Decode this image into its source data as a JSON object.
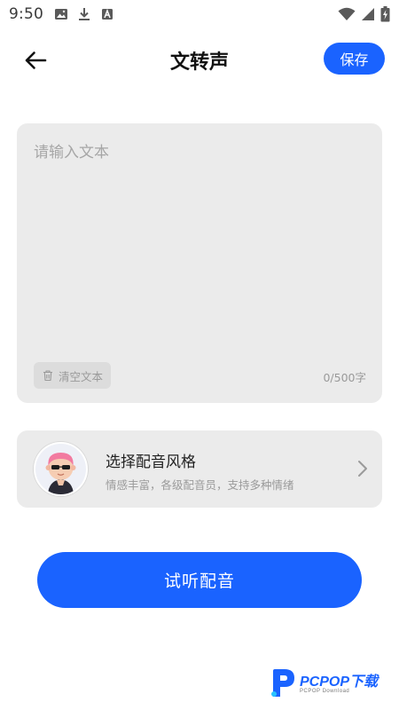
{
  "status_bar": {
    "time": "9:50",
    "icons_left": [
      "image-icon",
      "download-icon",
      "text-a-icon"
    ],
    "icons_right": [
      "wifi-icon",
      "signal-icon",
      "battery-charging-icon"
    ]
  },
  "header": {
    "back_icon": "arrow-left-icon",
    "title": "文转声",
    "save_label": "保存"
  },
  "text_input": {
    "placeholder": "请输入文本",
    "value": "",
    "clear_label": "清空文本",
    "clear_icon": "trash-icon",
    "char_count": "0/500字"
  },
  "voice_style": {
    "title": "选择配音风格",
    "subtitle": "情感丰富，各级配音员，支持多种情绪",
    "avatar_icon": "avatar-icon",
    "chevron_icon": "chevron-right-icon"
  },
  "preview_label": "试听配音",
  "watermark": {
    "text": "PCPOP下载",
    "sub": "PCPOP Download"
  },
  "colors": {
    "accent": "#1a63ff",
    "card_bg": "#ebebeb",
    "muted_text": "#9a9a9a",
    "placeholder": "#a6a6a6"
  }
}
